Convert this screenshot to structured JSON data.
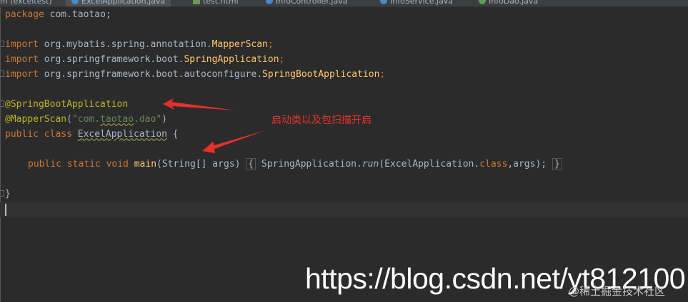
{
  "tabs": [
    {
      "label": "m (exceltest)"
    },
    {
      "label": "ExcelApplication.java",
      "active": true
    },
    {
      "label": "test.html"
    },
    {
      "label": "InfoController.java"
    },
    {
      "label": "InfoService.java"
    },
    {
      "label": "InfoDao.java"
    }
  ],
  "code": {
    "package_kw": "package",
    "package_name": " com.taotao;",
    "import_kw": "import",
    "import1_pkg": " org.mybatis.spring.annotation.",
    "import1_cls": "MapperScan",
    "import2_pkg": " org.springframework.boot.",
    "import2_cls": "SpringApplication",
    "import3_pkg": " org.springframework.boot.autoconfigure.",
    "import3_cls": "SpringBootApplication",
    "semi": ";",
    "ann1": "@SpringBootApplication",
    "ann2": "@MapperScan",
    "ann2_open": "(",
    "ann2_str_a": "\"com.",
    "ann2_str_b": "taotao",
    "ann2_str_c": ".dao\"",
    "ann2_close": ")",
    "class_kw": "public class",
    "class_name": "ExcelApplication",
    "class_open": " {",
    "main_kw": "public static void",
    "main_name": "main",
    "main_params": "(String[] args)",
    "fold_open": "{",
    "main_body_a": " SpringApplication.",
    "main_body_run": "run",
    "main_body_b": "(ExcelApplication.",
    "main_body_class": "class",
    "main_body_c": ",args); ",
    "fold_close": "}",
    "class_close": "}"
  },
  "annotation": {
    "text": "启动类以及包扫描开启",
    "color": "#e8302a"
  },
  "watermark": {
    "text": "https://blog.csdn.net/yt812100",
    "sub": "@稀土掘金技术社区"
  },
  "colors": {
    "background": "#2b2b2b",
    "keyword": "#cc7832",
    "annotation": "#bbb529",
    "string": "#6a8759",
    "function": "#ffc66d",
    "text": "#a9b7c6"
  }
}
